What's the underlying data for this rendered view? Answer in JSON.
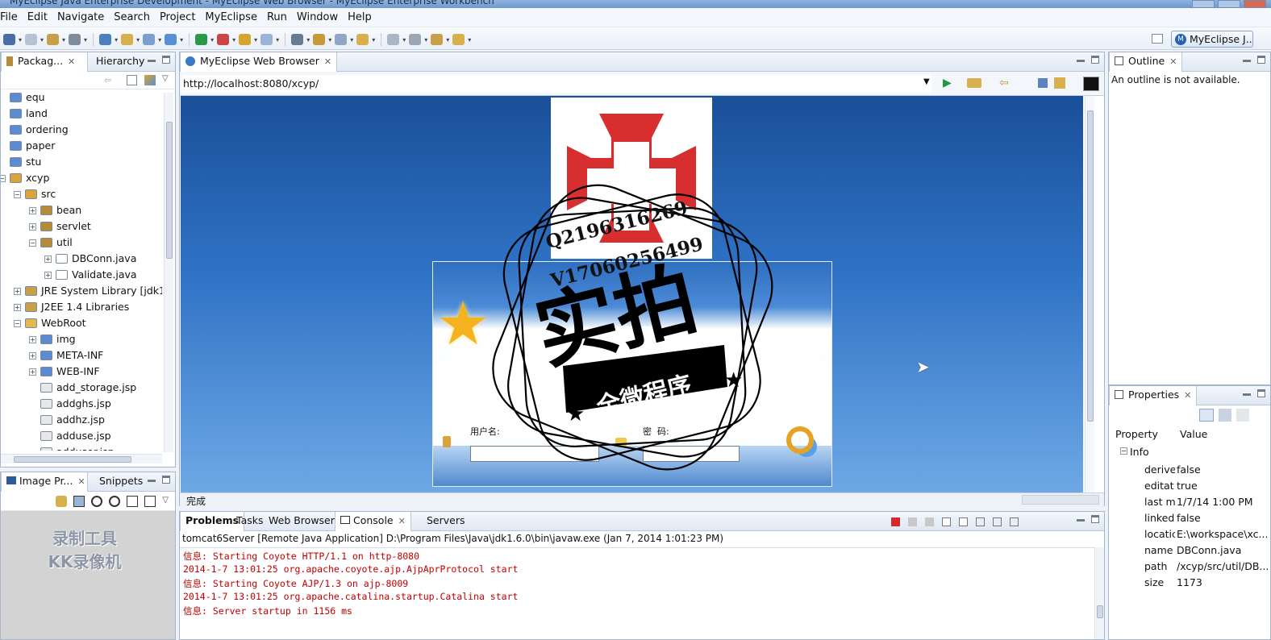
{
  "window": {
    "title": "MyEclipse Java Enterprise Development - MyEclipse Web Browser - MyEclipse Enterprise Workbench"
  },
  "menu": [
    "File",
    "Edit",
    "Navigate",
    "Search",
    "Project",
    "MyEclipse",
    "Run",
    "Window",
    "Help"
  ],
  "perspective": {
    "label": "MyEclipse J..."
  },
  "package_explorer": {
    "tabs": [
      "Packag...",
      "Hierarchy"
    ],
    "items": [
      {
        "label": "equ",
        "depth": 1,
        "icon": "folder-icon",
        "expander": ""
      },
      {
        "label": "land",
        "depth": 1,
        "icon": "folder-icon",
        "expander": ""
      },
      {
        "label": "ordering",
        "depth": 1,
        "icon": "folder-icon",
        "expander": ""
      },
      {
        "label": "paper",
        "depth": 1,
        "icon": "folder-icon",
        "expander": ""
      },
      {
        "label": "stu",
        "depth": 1,
        "icon": "folder-icon",
        "expander": ""
      },
      {
        "label": "xcyp",
        "depth": 1,
        "icon": "project-icon",
        "expander": "−"
      },
      {
        "label": "src",
        "depth": 2,
        "icon": "source-folder-icon",
        "expander": "−"
      },
      {
        "label": "bean",
        "depth": 3,
        "icon": "package-icon",
        "expander": "+"
      },
      {
        "label": "servlet",
        "depth": 3,
        "icon": "package-icon",
        "expander": "+"
      },
      {
        "label": "util",
        "depth": 3,
        "icon": "package-icon",
        "expander": "−"
      },
      {
        "label": "DBConn.java",
        "depth": 4,
        "icon": "java-file-icon",
        "expander": "+"
      },
      {
        "label": "Validate.java",
        "depth": 4,
        "icon": "java-file-icon",
        "expander": "+"
      },
      {
        "label": "JRE System Library [jdk1",
        "depth": 2,
        "icon": "library-icon",
        "expander": "+"
      },
      {
        "label": "J2EE 1.4 Libraries",
        "depth": 2,
        "icon": "library-icon",
        "expander": "+"
      },
      {
        "label": "WebRoot",
        "depth": 2,
        "icon": "open-folder-icon",
        "expander": "−"
      },
      {
        "label": "img",
        "depth": 3,
        "icon": "folder-icon",
        "expander": "+"
      },
      {
        "label": "META-INF",
        "depth": 3,
        "icon": "folder-icon",
        "expander": "+"
      },
      {
        "label": "WEB-INF",
        "depth": 3,
        "icon": "folder-icon",
        "expander": "+"
      },
      {
        "label": "add_storage.jsp",
        "depth": 3,
        "icon": "jsp-file-icon",
        "expander": ""
      },
      {
        "label": "addghs.jsp",
        "depth": 3,
        "icon": "jsp-file-icon",
        "expander": ""
      },
      {
        "label": "addhz.jsp",
        "depth": 3,
        "icon": "jsp-file-icon",
        "expander": ""
      },
      {
        "label": "adduse.jsp",
        "depth": 3,
        "icon": "jsp-file-icon",
        "expander": ""
      },
      {
        "label": "adduser.jsp",
        "depth": 3,
        "icon": "jsp-file-icon",
        "expander": ""
      }
    ]
  },
  "image_panel": {
    "tabs": [
      "Image Pr...",
      "Snippets"
    ],
    "watermark_line1": "录制工具",
    "watermark_line2": "KK录像机"
  },
  "editor": {
    "tab": "MyEclipse Web Browser",
    "url": "http://localhost:8080/xcyp/",
    "status": "完成",
    "login": {
      "username_label": "用户名:",
      "password_label": "密  码:"
    }
  },
  "stamp": {
    "qq": "Q2196316269",
    "wechat": "V17060256499",
    "big_text": "实拍",
    "banner": "全微程序"
  },
  "console": {
    "tabs": [
      "Problems",
      "Tasks",
      "Web Browser",
      "Console",
      "Servers"
    ],
    "header": "tomcat6Server [Remote Java Application] D:\\Program Files\\Java\\jdk1.6.0\\bin\\javaw.exe (Jan 7, 2014 1:01:23 PM)",
    "lines": [
      "信息: Starting Coyote HTTP/1.1 on http-8080",
      "2014-1-7 13:01:25 org.apache.coyote.ajp.AjpAprProtocol start",
      "信息: Starting Coyote AJP/1.3 on ajp-8009",
      "2014-1-7 13:01:25 org.apache.catalina.startup.Catalina start",
      "信息: Server startup in 1156 ms"
    ]
  },
  "outline": {
    "tab": "Outline",
    "message": "An outline is not available."
  },
  "properties": {
    "tab": "Properties",
    "col_property": "Property",
    "col_value": "Value",
    "group": "Info",
    "rows": [
      {
        "key": "derive",
        "value": "false"
      },
      {
        "key": "editat",
        "value": "true"
      },
      {
        "key": "last m",
        "value": "1/7/14 1:00 PM"
      },
      {
        "key": "linked",
        "value": "false"
      },
      {
        "key": "locatic",
        "value": "E:\\workspace\\xc..."
      },
      {
        "key": "name",
        "value": "DBConn.java"
      },
      {
        "key": "path",
        "value": "/xcyp/src/util/DB..."
      },
      {
        "key": "size",
        "value": "1173"
      }
    ]
  },
  "colors": {
    "accent": "#2f73c6",
    "console_text": "#c00000",
    "cross_red": "#d72f2f"
  }
}
